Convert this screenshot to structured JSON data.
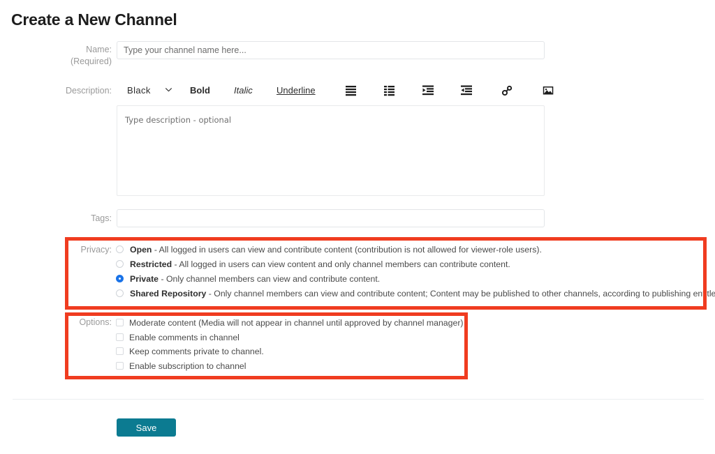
{
  "page": {
    "title": "Create a New Channel"
  },
  "name_field": {
    "label": "Name:",
    "sublabel": "(Required)",
    "placeholder": "Type your channel name here...",
    "value": ""
  },
  "description_field": {
    "label": "Description:",
    "placeholder": "Type description - optional",
    "value": "",
    "toolbar": {
      "color_value": "Black",
      "caret": "⌄",
      "bold_label": "Bold",
      "italic_label": "Italic",
      "underline_label": "Underline",
      "icons": [
        "unordered-list-icon",
        "ordered-list-icon",
        "indent-increase-icon",
        "indent-decrease-icon",
        "link-icon",
        "image-icon"
      ]
    }
  },
  "tags_field": {
    "label": "Tags:",
    "placeholder": "",
    "value": ""
  },
  "privacy": {
    "label": "Privacy:",
    "selected": "Private",
    "options": [
      {
        "name": "Open",
        "description": " - All logged in users can view and contribute content (contribution is not allowed for viewer-role users).",
        "checked": false
      },
      {
        "name": "Restricted",
        "description": " - All logged in users can view content and only channel members can contribute content.",
        "checked": false
      },
      {
        "name": "Private",
        "description": " - Only channel members can view and contribute content.",
        "checked": true
      },
      {
        "name": "Shared Repository",
        "description": " - Only channel members can view and contribute content; Content may be published to other channels, according to publishing entitlements.",
        "checked": false
      }
    ]
  },
  "options": {
    "label": "Options:",
    "items": [
      {
        "label": "Moderate content (Media will not appear in channel until approved by channel manager)",
        "checked": false
      },
      {
        "label": "Enable comments in channel",
        "checked": false
      },
      {
        "label": "Keep comments private to channel.",
        "checked": false
      },
      {
        "label": "Enable subscription to channel",
        "checked": false
      }
    ]
  },
  "footer": {
    "save_label": "Save"
  },
  "colors": {
    "highlight": "#f03c20",
    "save_button": "#0c7b91",
    "radio_selected": "#1a73e8",
    "label_text": "#9a9a9a"
  }
}
